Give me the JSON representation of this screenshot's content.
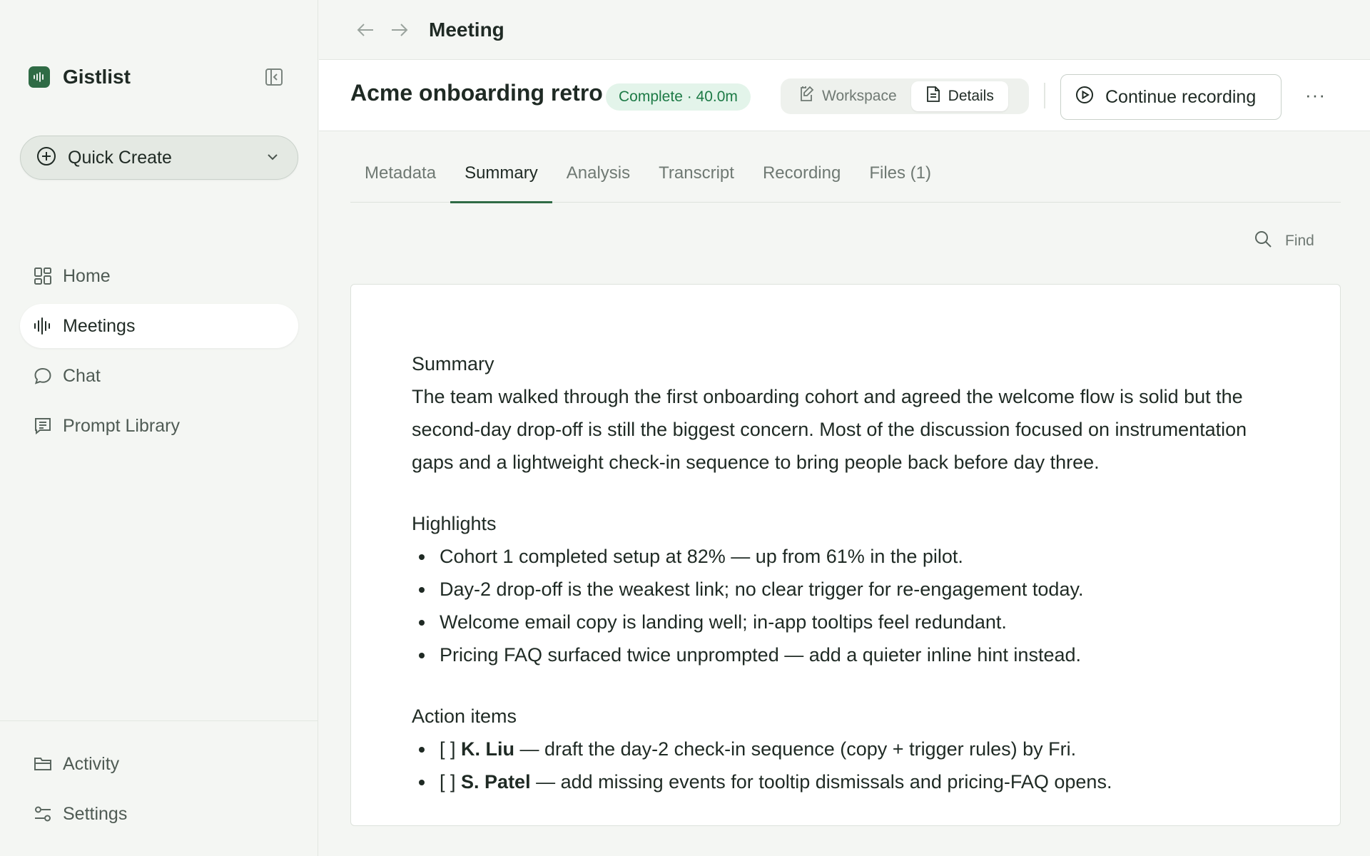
{
  "app": {
    "name": "Gistlist"
  },
  "sidebar": {
    "quick_create": "Quick Create",
    "items": [
      {
        "label": "Home",
        "icon": "grid-icon"
      },
      {
        "label": "Meetings",
        "icon": "waveform-icon"
      },
      {
        "label": "Chat",
        "icon": "chat-bubble-icon"
      },
      {
        "label": "Prompt Library",
        "icon": "prompt-list-icon"
      }
    ],
    "bottom_items": [
      {
        "label": "Activity",
        "icon": "folder-icon"
      },
      {
        "label": "Settings",
        "icon": "sliders-icon"
      }
    ]
  },
  "topbar": {
    "breadcrumb": "Meeting"
  },
  "meeting": {
    "title": "Acme onboarding retro",
    "status": "Complete · 40.0m",
    "views": {
      "workspace": "Workspace",
      "details": "Details",
      "active": "Details"
    },
    "continue_recording": "Continue recording",
    "more": "···"
  },
  "tabs": [
    "Metadata",
    "Summary",
    "Analysis",
    "Transcript",
    "Recording",
    "Files (1)"
  ],
  "active_tab": "Summary",
  "find": {
    "label": "Find"
  },
  "content": {
    "summary_title": "Summary",
    "summary_text": "The team walked through the first onboarding cohort and agreed the welcome flow is solid but the second-day drop-off is still the biggest concern. Most of the discussion focused on instrumentation gaps and a lightweight check-in sequence to bring people back before day three.",
    "highlights_title": "Highlights",
    "highlights": [
      "Cohort 1 completed setup at 82% — up from 61% in the pilot.",
      "Day-2 drop-off is the weakest link; no clear trigger for re-engagement today.",
      "Welcome email copy is landing well; in-app tooltips feel redundant.",
      "Pricing FAQ surfaced twice unprompted — add a quieter inline hint instead."
    ],
    "actions_title": "Action items",
    "actions": [
      {
        "checkbox": "[ ]",
        "owner": "K. Liu",
        "text": " — draft the day-2 check-in sequence (copy + trigger rules) by Fri."
      },
      {
        "checkbox": "[ ]",
        "owner": "S. Patel",
        "text": " — add missing events for tooltip dismissals and pricing-FAQ opens."
      }
    ]
  },
  "colors": {
    "accent": "#2f6b45",
    "status_bg": "#e3f4ea",
    "status_text": "#1d7a46",
    "background": "#f4f6f3"
  }
}
